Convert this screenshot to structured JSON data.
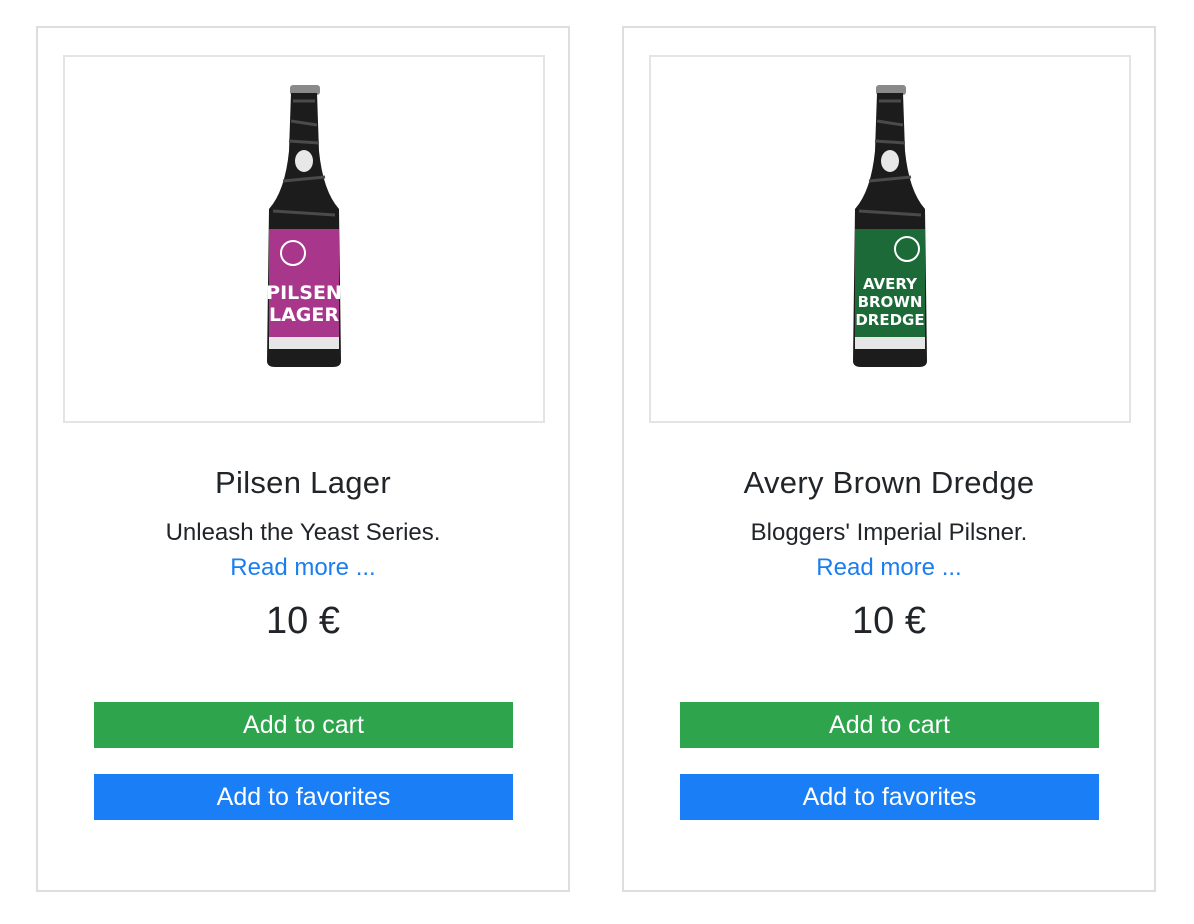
{
  "products": [
    {
      "name": "Pilsen Lager",
      "tagline": "Unleash the Yeast Series.",
      "read_more": "Read more ...",
      "price": "10 €",
      "add_to_cart": "Add to cart",
      "add_to_favorites": "Add to favorites",
      "label_color": "#a8378c",
      "label_text": [
        "PILSEN",
        "LAGER"
      ]
    },
    {
      "name": "Avery Brown Dredge",
      "tagline": "Bloggers' Imperial Pilsner.",
      "read_more": "Read more ...",
      "price": "10 €",
      "add_to_cart": "Add to cart",
      "add_to_favorites": "Add to favorites",
      "label_color": "#1b6a37",
      "label_text": [
        "AVERY",
        "BROWN",
        "DREDGE"
      ]
    }
  ]
}
